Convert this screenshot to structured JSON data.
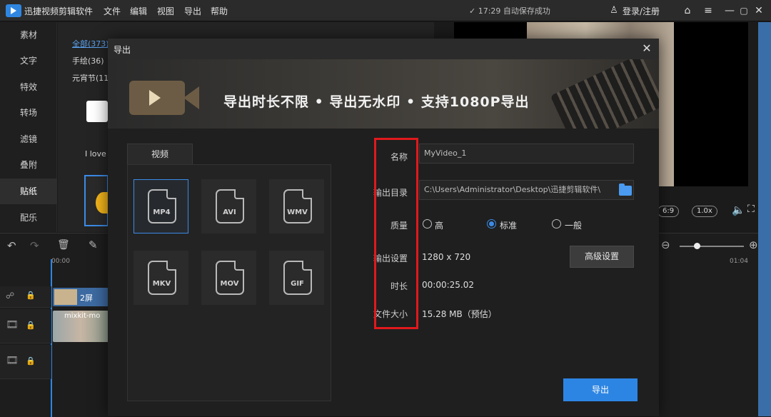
{
  "app": {
    "title": "迅捷视频剪辑软件",
    "menu": [
      "文件",
      "编辑",
      "视图",
      "导出",
      "帮助"
    ],
    "autosave": "✓ 17:29 自动保存成功",
    "login": "登录/注册"
  },
  "sidebar": {
    "items": [
      {
        "label": "素材"
      },
      {
        "label": "文字"
      },
      {
        "label": "特效"
      },
      {
        "label": "转场"
      },
      {
        "label": "滤镜"
      },
      {
        "label": "叠附"
      },
      {
        "label": "贴纸"
      },
      {
        "label": "配乐"
      }
    ],
    "active_index": 6
  },
  "material": {
    "categories": [
      "全部(373)",
      "手绘(36)",
      "元宵节(11)"
    ],
    "sticker_text": "I love"
  },
  "preview_controls": {
    "aspect": "6:9",
    "speed": "1.0x",
    "time_end": "01:04"
  },
  "timeline": {
    "time_start": "00:00",
    "clip1_label": "2屏",
    "clip2_label": "mixkit-mo"
  },
  "dialog": {
    "title": "导出",
    "banner": "导出时长不限 • 导出无水印 • 支持1080P导出",
    "format_tab": "视频",
    "formats": [
      "MP4",
      "AVI",
      "WMV",
      "MKV",
      "MOV",
      "GIF"
    ],
    "selected_format": "MP4",
    "labels": {
      "name": "名称",
      "output_dir": "输出目录",
      "quality": "质量",
      "output_settings": "输出设置",
      "duration": "时长",
      "file_size": "文件大小"
    },
    "values": {
      "name": "MyVideo_1",
      "output_dir": "C:\\Users\\Administrator\\Desktop\\迅捷剪辑软件\\",
      "resolution": "1280 x 720",
      "duration": "00:00:25.02",
      "file_size": "15.28 MB（预估）"
    },
    "quality_options": [
      "高",
      "标准",
      "一般"
    ],
    "quality_selected": "标准",
    "advanced_button": "高级设置",
    "export_button": "导出"
  },
  "colors": {
    "accent": "#2d85e3",
    "highlight_box": "#e0191d"
  }
}
